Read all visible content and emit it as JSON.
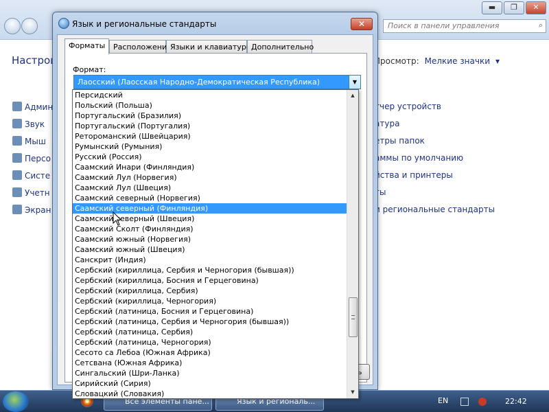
{
  "control_panel": {
    "heading": "Настрой",
    "view_label": "Просмотр:",
    "view_value": "Мелкие значки",
    "search_placeholder": "Поиск в панели управления",
    "left_items": [
      "Админ",
      "Звук",
      "Мыш",
      "Персо",
      "Систе",
      "Учетн",
      "Экран"
    ],
    "right_items": [
      "тчер устройств",
      "атура",
      "етры папок",
      "аммы по умолчанию",
      "йства и принтеры",
      "ты",
      "и региональные стандарты"
    ],
    "window_buttons": {
      "minimize": "▬",
      "maximize": "❐",
      "close": "✕"
    }
  },
  "dialog": {
    "title": "Язык и региональные стандарты",
    "close_glyph": "✕",
    "tabs": [
      {
        "label": "Форматы",
        "active": true
      },
      {
        "label": "Расположение",
        "active": false
      },
      {
        "label": "Языки и клавиатуры",
        "active": false
      },
      {
        "label": "Дополнительно",
        "active": false
      }
    ],
    "format_label": "Формат:",
    "format_selected": "Лаосский (Лаосская Народно-Демократическая Республика)",
    "partial_button": "ь"
  },
  "dropdown": {
    "selected_index": 11,
    "items": [
      "Персидский",
      "Польский (Польша)",
      "Португальский (Бразилия)",
      "Португальский (Португалия)",
      "Ретороманский (Швейцария)",
      "Румынский (Румыния)",
      "Русский (Россия)",
      "Саамский Инари (Финляндия)",
      "Саамский Лул (Норвегия)",
      "Саамский Лул (Швеция)",
      "Саамский северный (Норвегия)",
      "Саамский северный (Финляндия)",
      "Саамский северный (Швеция)",
      "Саамский Сколт (Финляндия)",
      "Саамский южный (Норвегия)",
      "Саамский южный (Швеция)",
      "Санскрит (Индия)",
      "Сербский (кириллица, Сербия и Черногория (бывшая))",
      "Сербский (кириллица, Босния и Герцеговина)",
      "Сербский (кириллица, Сербия)",
      "Сербский (кириллица, Черногория)",
      "Сербский (латиница, Босния и Герцеговина)",
      "Сербский (латиница, Сербия и Черногория (бывшая))",
      "Сербский (латиница, Сербия)",
      "Сербский (латиница, Черногория)",
      "Сесото са Лебоа (Южная Африка)",
      "Сетсвана (Южная Африка)",
      "Сингальский (Шри-Ланка)",
      "Сирийский (Сирия)",
      "Словацкий (Словакия)"
    ]
  },
  "taskbar": {
    "apps": [
      "Все элементы пане...",
      "Язык и региональ..."
    ],
    "language": "EN",
    "clock": "22:42"
  },
  "colors": {
    "selection": "#3399ff",
    "link": "#1e3287",
    "taskbar": "#1f3656"
  }
}
